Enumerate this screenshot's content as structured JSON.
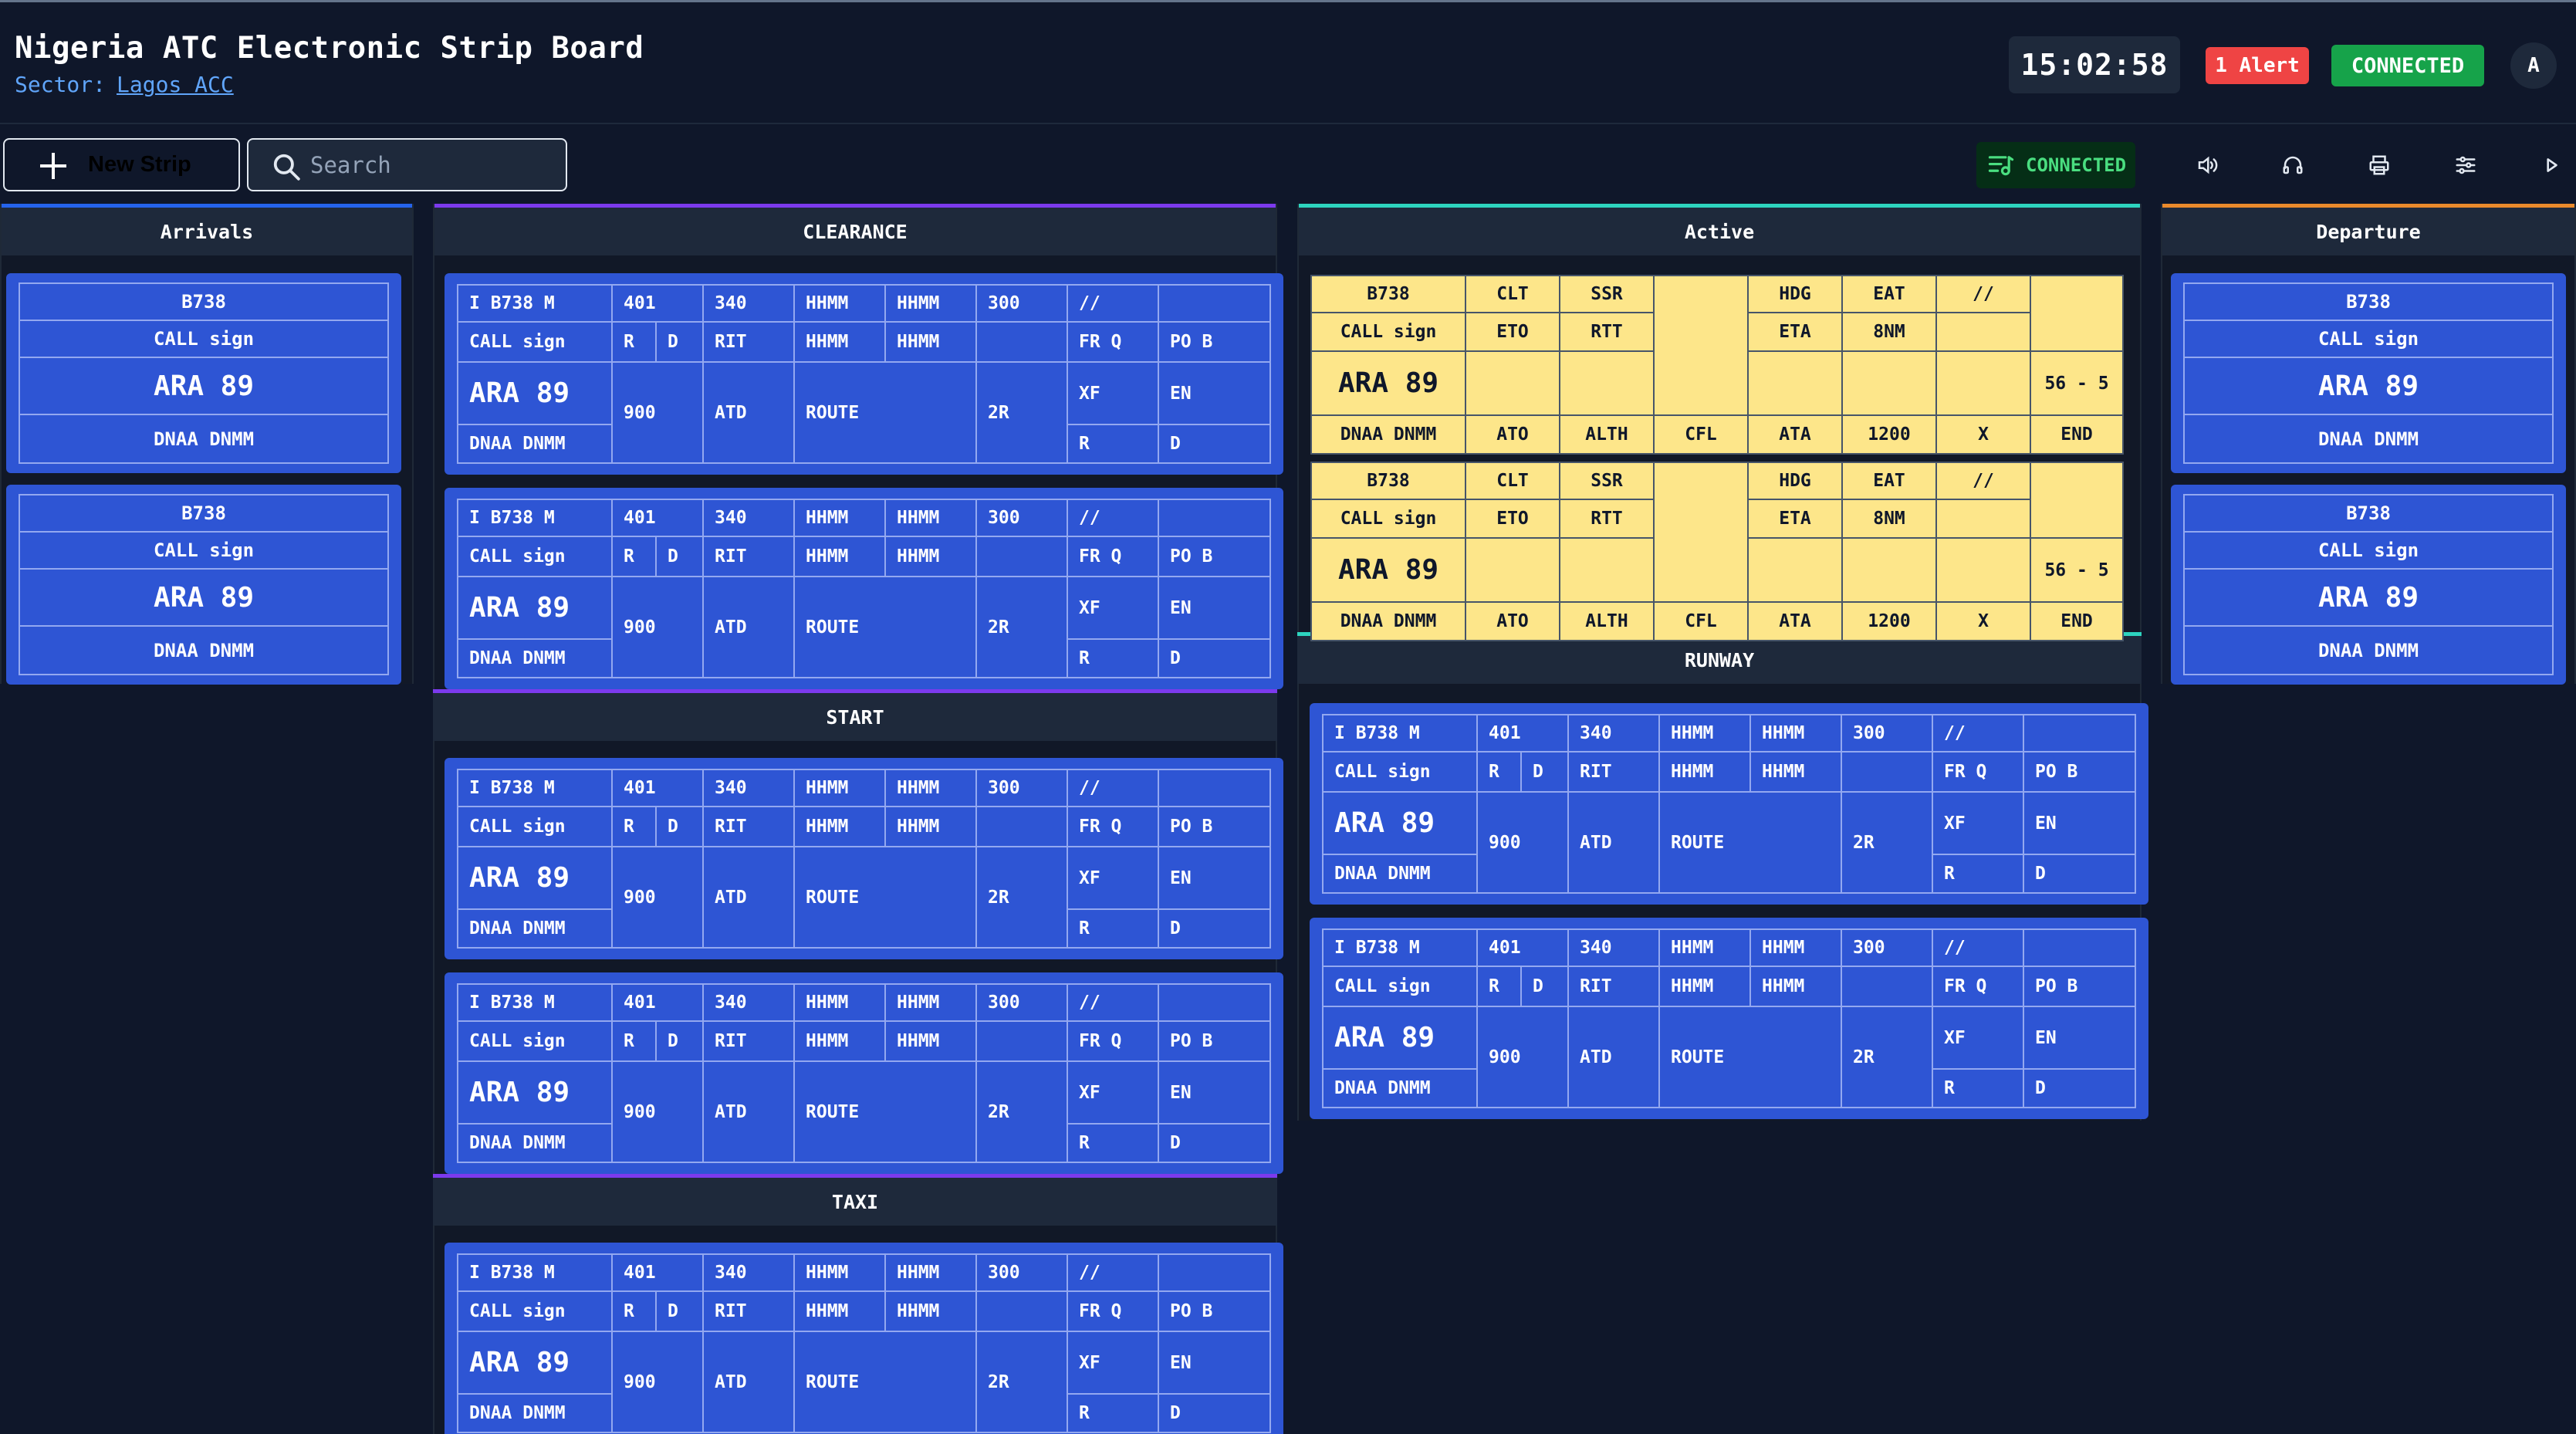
{
  "app": {
    "title": "Nigeria ATC Electronic Strip Board",
    "sector_label": "Sector:",
    "sector_value": "Lagos ACC",
    "clock": "15:02:58",
    "alert": "1 Alert",
    "status": "CONNECTED",
    "avatar": "A"
  },
  "toolbar": {
    "new_strip": "New Strip",
    "search_placeholder": "Search",
    "connected": "CONNECTED",
    "icons": [
      "sound-icon",
      "headset-icon",
      "print-icon",
      "settings-sliders-icon",
      "play-icon"
    ]
  },
  "columns": {
    "arrivals": "Arrivals",
    "clearance": "CLEARANCE",
    "start": "START",
    "taxi": "TAXI",
    "active": "Active",
    "runway": "RUNWAY",
    "departure": "Departure"
  },
  "colors": {
    "arrivals": "#2563eb",
    "clearance": "#7c3aed",
    "active": "#2dd4bf",
    "departure": "#ea8a2c",
    "strip_blue": "#2e55d4",
    "strip_yellow": "#fde68a"
  },
  "small_strip": {
    "type": "B738",
    "callsign_label": "CALL sign",
    "callsign": "ARA 89",
    "route": "DNAA DNMM"
  },
  "blue_strip": {
    "r1": [
      "I B738 M",
      "401",
      "340",
      "HHMM",
      "HHMM",
      "300",
      "//",
      ""
    ],
    "r2_call": "CALL sign",
    "r2_r": "R",
    "r2_d": "D",
    "r2": [
      "RIT",
      "HHMM",
      "HHMM",
      "",
      "FR Q",
      "PO B"
    ],
    "callsign": "ARA 89",
    "mid": [
      "900",
      "ATD",
      "ROUTE",
      "2R"
    ],
    "xf": "XF",
    "en": "EN",
    "route": "DNAA DNMM",
    "r4": [
      "R",
      "D"
    ]
  },
  "yellow_strip": {
    "r1": [
      "B738",
      "CLT",
      "SSR",
      "",
      "HDG",
      "EAT",
      "//",
      ""
    ],
    "r2": [
      "CALL sign",
      "ETO",
      "RTT",
      "ETA",
      "8NM",
      ""
    ],
    "callsign": "ARA 89",
    "range": "56 - 5",
    "r4": [
      "DNAA DNMM",
      "ATO",
      "ALTH",
      "CFL",
      "ATA",
      "1200",
      "X",
      "END"
    ]
  }
}
